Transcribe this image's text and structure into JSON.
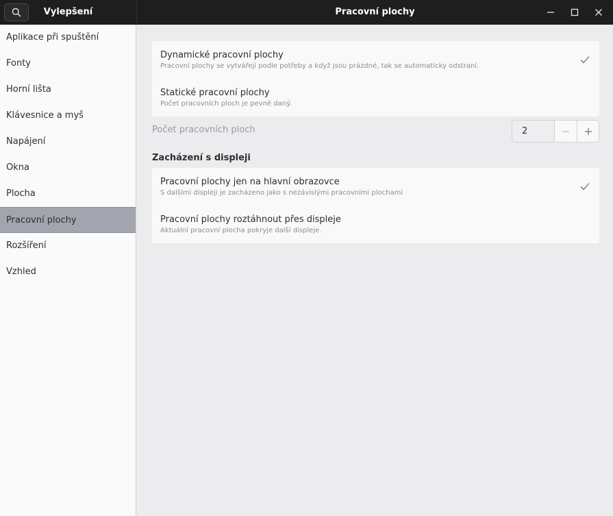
{
  "sidebar": {
    "title": "Vylepšení",
    "items": [
      {
        "label": "Aplikace při spuštění"
      },
      {
        "label": "Fonty"
      },
      {
        "label": "Horní lišta"
      },
      {
        "label": "Klávesnice a myš"
      },
      {
        "label": "Napájení"
      },
      {
        "label": "Okna"
      },
      {
        "label": "Plocha"
      },
      {
        "label": "Pracovní plochy"
      },
      {
        "label": "Rozšíření"
      },
      {
        "label": "Vzhled"
      }
    ],
    "selected_index": 7
  },
  "header": {
    "title": "Pracovní plochy"
  },
  "workspace_mode": {
    "options": [
      {
        "title": "Dynamické pracovní plochy",
        "subtitle": "Pracovní plochy se vytvářejí podle potřeby a když jsou prázdné, tak se automaticky odstraní.",
        "checked": true
      },
      {
        "title": "Statické pracovní plochy",
        "subtitle": "Počet pracovních ploch je pevně daný.",
        "checked": false
      }
    ]
  },
  "workspace_count": {
    "label": "Počet pracovních ploch",
    "value": "2"
  },
  "displays": {
    "section_title": "Zacházení s displeji",
    "options": [
      {
        "title": "Pracovní plochy jen na hlavní obrazovce",
        "subtitle": "S dalšími displeji je zacházeno jako s nezávislými pracovními plochami",
        "checked": true
      },
      {
        "title": "Pracovní plochy roztáhnout přes displeje",
        "subtitle": "Aktuální pracovní plocha pokryje další displeje.",
        "checked": false
      }
    ]
  },
  "icons": {
    "search": "search-icon",
    "minimize": "minimize-icon",
    "maximize": "maximize-icon",
    "close": "close-icon",
    "check": "check-icon",
    "minus": "minus-icon",
    "plus": "plus-icon"
  },
  "colors": {
    "headerbar": "#1e1e1f",
    "sidebar_bg": "#fafafa",
    "selected_bg": "#a2a5ad",
    "content_bg": "#ececee",
    "card_bg": "#f9f9fa"
  }
}
